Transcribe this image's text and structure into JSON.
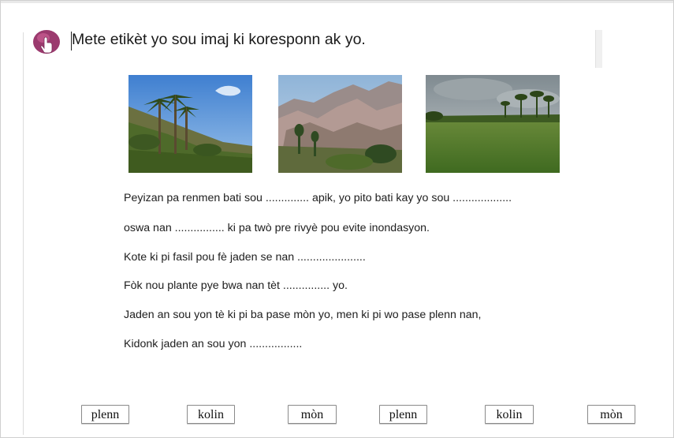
{
  "exercise": {
    "instruction": "Mete etikèt yo sou imaj ki koresponn ak yo.",
    "icon": "drag-label-icon",
    "images": [
      {
        "name": "palm-hillside-photo"
      },
      {
        "name": "mountain-photo"
      },
      {
        "name": "plain-field-photo"
      }
    ],
    "sentences": [
      "Peyizan pa renmen bati sou .............. apik, yo pito bati kay yo sou ...................",
      "oswa nan ................ ki pa twò pre rivyè pou evite inondasyon.",
      "Kote ki pi fasil pou fè jaden se nan ......................",
      "Fòk nou plante pye bwa nan tèt ............... yo.",
      "Jaden an sou yon tè ki pi ba pase mòn yo, men ki pi wo pase plenn nan,",
      "Kidonk jaden an sou  yon ................."
    ],
    "labels": [
      "plenn",
      "kolin",
      "mòn",
      "plenn",
      "kolin",
      "mòn"
    ]
  },
  "colors": {
    "icon_bg": "#9b3a6e",
    "text": "#202020",
    "button_border": "#8a8a8a"
  }
}
